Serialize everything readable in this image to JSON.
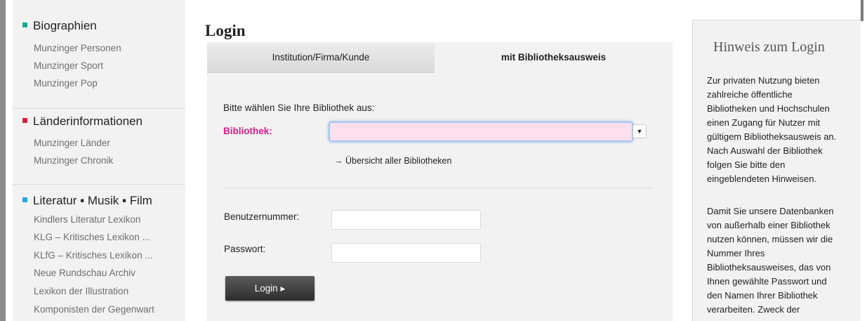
{
  "sidebar": {
    "sections": [
      {
        "title": "Biographien",
        "color": "#1aa98f",
        "items": [
          "Munzinger Personen",
          "Munzinger Sport",
          "Munzinger Pop"
        ]
      },
      {
        "title": "Länderinformationen",
        "color": "#d6203f",
        "items": [
          "Munzinger Länder",
          "Munzinger Chronik"
        ]
      },
      {
        "title": "Literatur ▪ Musik ▪ Film",
        "color": "#2aa5dc",
        "items": [
          "Kindlers Literatur Lexikon",
          "KLG – Kritisches Lexikon ...",
          "KLfG – Kritisches Lexikon ...",
          "Neue Rundschau Archiv",
          "Lexikon der Illustration",
          "Komponisten der Gegenwart"
        ]
      }
    ]
  },
  "main": {
    "title": "Login",
    "tabs": [
      {
        "label": "Institution/Firma/Kunde",
        "active": false
      },
      {
        "label": "mit Bibliotheksausweis",
        "active": true
      }
    ],
    "intro": "Bitte wählen Sie Ihre Bibliothek aus:",
    "library_label": "Bibliothek:",
    "library_value": "",
    "library_arrow_icon": "chevron-down-icon",
    "overview_link": "→ Übersicht aller Bibliotheken",
    "user_label": "Benutzernummer:",
    "user_value": "",
    "password_label": "Passwort:",
    "password_value": "",
    "login_button": "Login ▸"
  },
  "info": {
    "title": "Hinweis zum Login",
    "lines": [
      "Zur privaten Nutzung bieten",
      "zahlreiche öffentliche",
      "Bibliotheken und Hochschulen",
      "einen Zugang für Nutzer mit",
      "gültigem Bibliotheksausweis an.",
      "Nach Auswahl der Bibliothek",
      "folgen Sie bitte den",
      "eingeblendeten Hinweisen.",
      "",
      "Damit Sie unsere Datenbanken",
      "von außerhalb einer Bibliothek",
      "nutzen können, müssen wir die",
      "Nummer Ihres",
      "Bibliotheksausweises, das von",
      "Ihnen gewählte Passwort und",
      "den Namen Ihrer Bibliothek",
      "verarbeiten. Zweck der"
    ]
  },
  "colors": {
    "accent_magenta": "#d41e8a",
    "select_bg": "#fde0ee",
    "panel_bg": "#f2f2f2"
  }
}
